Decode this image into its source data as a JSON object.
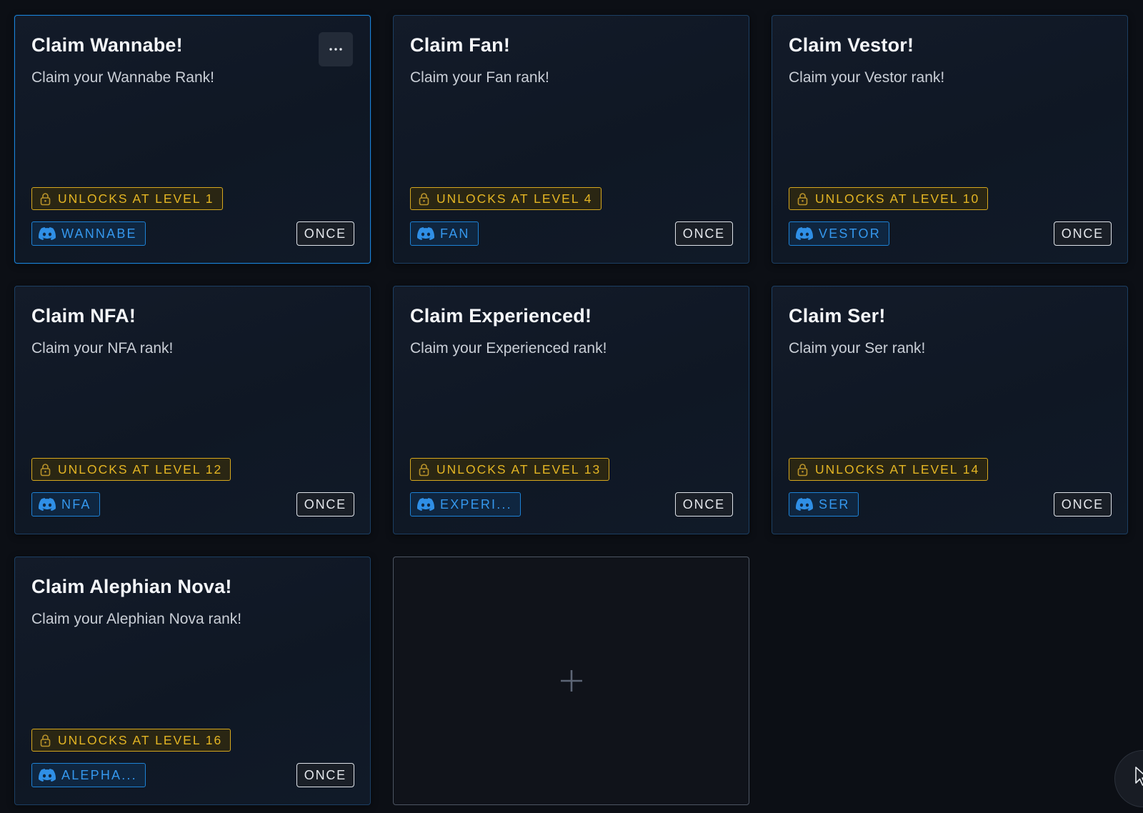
{
  "cards": [
    {
      "title": "Claim Wannabe!",
      "description": "Claim your Wannabe Rank!",
      "unlock": "UNLOCKS AT LEVEL 1",
      "role": "WANNABE",
      "frequency": "ONCE"
    },
    {
      "title": "Claim Fan!",
      "description": "Claim your Fan rank!",
      "unlock": "UNLOCKS AT LEVEL 4",
      "role": "FAN",
      "frequency": "ONCE"
    },
    {
      "title": "Claim Vestor!",
      "description": "Claim your Vestor rank!",
      "unlock": "UNLOCKS AT LEVEL 10",
      "role": "VESTOR",
      "frequency": "ONCE"
    },
    {
      "title": "Claim NFA!",
      "description": "Claim your NFA rank!",
      "unlock": "UNLOCKS AT LEVEL 12",
      "role": "NFA",
      "frequency": "ONCE"
    },
    {
      "title": "Claim Experienced!",
      "description": "Claim your Experienced rank!",
      "unlock": "UNLOCKS AT LEVEL 13",
      "role": "EXPERI...",
      "frequency": "ONCE"
    },
    {
      "title": "Claim Ser!",
      "description": "Claim your Ser rank!",
      "unlock": "UNLOCKS AT LEVEL 14",
      "role": "SER",
      "frequency": "ONCE"
    },
    {
      "title": "Claim Alephian Nova!",
      "description": "Claim your Alephian Nova rank!",
      "unlock": "UNLOCKS AT LEVEL 16",
      "role": "ALEPHA...",
      "frequency": "ONCE"
    }
  ],
  "icons": {
    "more": "more-horizontal-icon",
    "lock": "lock-icon",
    "role": "discord-icon",
    "add": "plus-icon",
    "cursor": "cursor-icon"
  },
  "colors": {
    "background": "#0c0f15",
    "card_border": "#1c3f63",
    "active_border": "#1a82d8",
    "unlock": "#e4b523",
    "role": "#3598ee",
    "once": "#e4e7ec"
  }
}
